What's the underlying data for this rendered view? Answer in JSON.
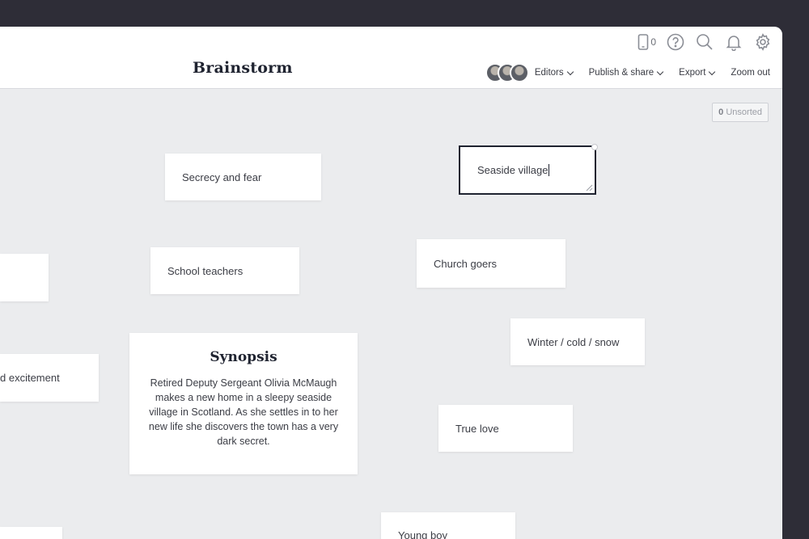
{
  "header": {
    "title": "Brainstorm",
    "phone_count": "0",
    "icons": [
      "phone-icon",
      "help-icon",
      "search-icon",
      "bell-icon",
      "gear-icon"
    ]
  },
  "menu": {
    "editors": "Editors",
    "publish": "Publish & share",
    "export": "Export",
    "zoom_out": "Zoom out"
  },
  "board": {
    "unsorted_count": "0",
    "unsorted_label": "Unsorted",
    "cards": {
      "secrecy": "Secrecy and fear",
      "seaside": "Seaside village",
      "school": "School teachers",
      "church": "Church goers",
      "winter": "Winter / cold / snow",
      "excitement": "d excitement",
      "true_love": "True love",
      "young_boy": "Young boy"
    },
    "synopsis": {
      "title": "Synopsis",
      "body": "Retired Deputy Sergeant Olivia McMaugh makes a new home in a sleepy seaside village in Scotland. As she settles in to her new life she discovers the town has a very dark secret."
    }
  },
  "colors": {
    "frame": "#2e2d37",
    "canvas": "#ebecee",
    "card": "#ffffff",
    "heading": "#1f2330"
  }
}
